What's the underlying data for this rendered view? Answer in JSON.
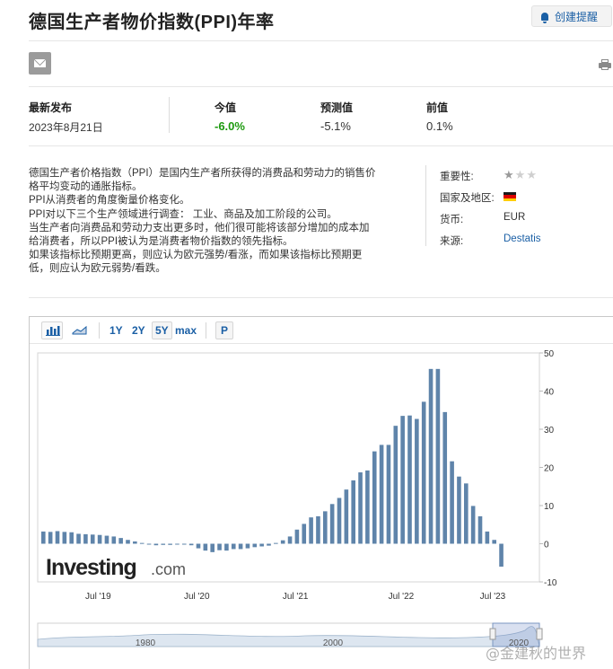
{
  "page": {
    "title": "德国生产者物价指数(PPI)年率",
    "alert_label": "创建提醒"
  },
  "stats": {
    "latest_label": "最新发布",
    "latest_date": "2023年8月21日",
    "actual_label": "今值",
    "actual_value": "-6.0%",
    "forecast_label": "预测值",
    "forecast_value": "-5.1%",
    "previous_label": "前值",
    "previous_value": "0.1%"
  },
  "description": [
    "德国生产者价格指数（PPI）是国内生产者所获得的消费品和劳动力的销售价",
    "格平均变动的通胀指标。",
    "PPI从消费者的角度衡量价格变化。",
    "PPI对以下三个生产领域进行调查：  工业、商品及加工阶段的公司。",
    "当生产者向消费品和劳动力支出更多时，他们很可能将该部分增加的成本加",
    "给消费者，所以PPI被认为是消费者物价指数的领先指标。",
    "如果该指标比预期更高，则应认为欧元强势/看涨，而如果该指标比预期更",
    "低，则应认为欧元弱势/看跌。"
  ],
  "info": {
    "importance_label": "重要性:",
    "country_label": "国家及地区:",
    "currency_label": "货币:",
    "currency_value": "EUR",
    "source_label": "来源:",
    "source_value": "Destatis",
    "importance_stars": 1,
    "flag_colors": [
      "#1a1a1a",
      "#dd0000",
      "#ffce00"
    ]
  },
  "toolbar": {
    "range_1y": "1Y",
    "range_2y": "2Y",
    "range_5y": "5Y",
    "range_max": "max",
    "p_label": "P"
  },
  "chart_data": {
    "type": "bar",
    "bar_color": "#5f84aa",
    "ylim": [
      -10,
      50
    ],
    "yticks": [
      -10,
      0,
      10,
      20,
      30,
      40,
      50
    ],
    "xtick_labels": [
      "Jul '19",
      "Jul '20",
      "Jul '21",
      "Jul '22",
      "Jul '23"
    ],
    "values": [
      3.2,
      3.1,
      3.3,
      3.1,
      3.0,
      2.6,
      2.5,
      2.4,
      2.3,
      2.1,
      1.9,
      1.5,
      1.0,
      0.6,
      0.2,
      -0.1,
      -0.4,
      -0.3,
      -0.3,
      -0.1,
      -0.1,
      -0.4,
      -1.2,
      -1.8,
      -2.2,
      -1.7,
      -1.8,
      -1.4,
      -1.4,
      -1.2,
      -0.9,
      -0.7,
      -0.5,
      0.2,
      0.9,
      1.9,
      3.7,
      5.2,
      6.9,
      7.2,
      8.5,
      10.4,
      12.0,
      14.2,
      16.6,
      18.7,
      19.2,
      24.2,
      25.9,
      25.9,
      30.9,
      33.5,
      33.6,
      32.7,
      37.2,
      45.8,
      45.8,
      34.5,
      21.6,
      17.6,
      15.8,
      9.9,
      7.2,
      3.2,
      1.0,
      -6.0
    ],
    "logo_text_main": "Investing",
    "logo_text_suffix": ".com",
    "navigator_labels": [
      "1980",
      "2000",
      "2020"
    ]
  },
  "watermark": "@金建秋的世界"
}
